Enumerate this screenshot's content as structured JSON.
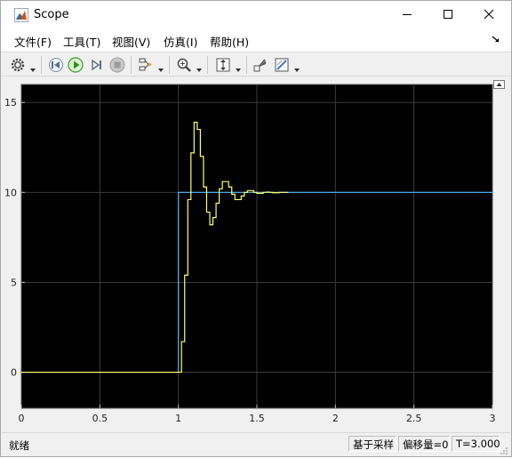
{
  "window": {
    "title": "Scope"
  },
  "menu": [
    {
      "label": "文件(F)"
    },
    {
      "label": "工具(T)"
    },
    {
      "label": "视图(V)"
    },
    {
      "label": "仿真(I)"
    },
    {
      "label": "帮助(H)"
    }
  ],
  "toolbar": {
    "icons": [
      "gear-icon",
      "step-back-icon",
      "run-icon",
      "step-forward-icon",
      "stop-icon",
      "signal-selector-icon",
      "zoom-icon",
      "autoscale-icon",
      "highlight-block-icon",
      "style-icon"
    ]
  },
  "chart_data": {
    "type": "line",
    "background": "#000000",
    "xlim": [
      0,
      3
    ],
    "ylim": [
      -2,
      16
    ],
    "x_ticks": [
      0,
      0.5,
      1,
      1.5,
      2,
      2.5,
      3
    ],
    "x_tick_labels": [
      "0",
      "0.5",
      "1",
      "1.5",
      "2",
      "2.5",
      "3"
    ],
    "y_ticks": [
      0,
      5,
      10,
      15
    ],
    "y_tick_labels": [
      "0",
      "5",
      "10",
      "15"
    ],
    "grid": true,
    "series": [
      {
        "color": "#4db8ff",
        "step": true,
        "x": [
          0,
          1.0,
          1.0,
          3.0
        ],
        "y": [
          0,
          0,
          10,
          10
        ]
      },
      {
        "color": "#ffff66",
        "step": true,
        "x": [
          0,
          1.0,
          1.02,
          1.04,
          1.06,
          1.08,
          1.1,
          1.12,
          1.14,
          1.16,
          1.18,
          1.2,
          1.22,
          1.24,
          1.26,
          1.28,
          1.3,
          1.32,
          1.34,
          1.36,
          1.38,
          1.4,
          1.42,
          1.44,
          1.46,
          1.48,
          1.5,
          1.52,
          1.54,
          1.56,
          1.58,
          1.6,
          1.62,
          1.64,
          1.66,
          1.68,
          1.7
        ],
        "y": [
          0,
          0,
          1.7,
          5.4,
          9.6,
          12.2,
          13.9,
          13.5,
          12.0,
          10.3,
          8.9,
          8.2,
          8.6,
          9.4,
          10.2,
          10.6,
          10.6,
          10.3,
          9.9,
          9.6,
          9.6,
          9.8,
          10.0,
          10.1,
          10.1,
          10.0,
          9.95,
          9.95,
          10.0,
          10.02,
          10.0,
          9.98,
          9.98,
          10.0,
          10.0,
          10.0,
          10.0
        ]
      }
    ]
  },
  "status": {
    "left_text": "就绪",
    "sample_based": "基于采样",
    "offset": "偏移量=0",
    "time": "T=3.000"
  }
}
